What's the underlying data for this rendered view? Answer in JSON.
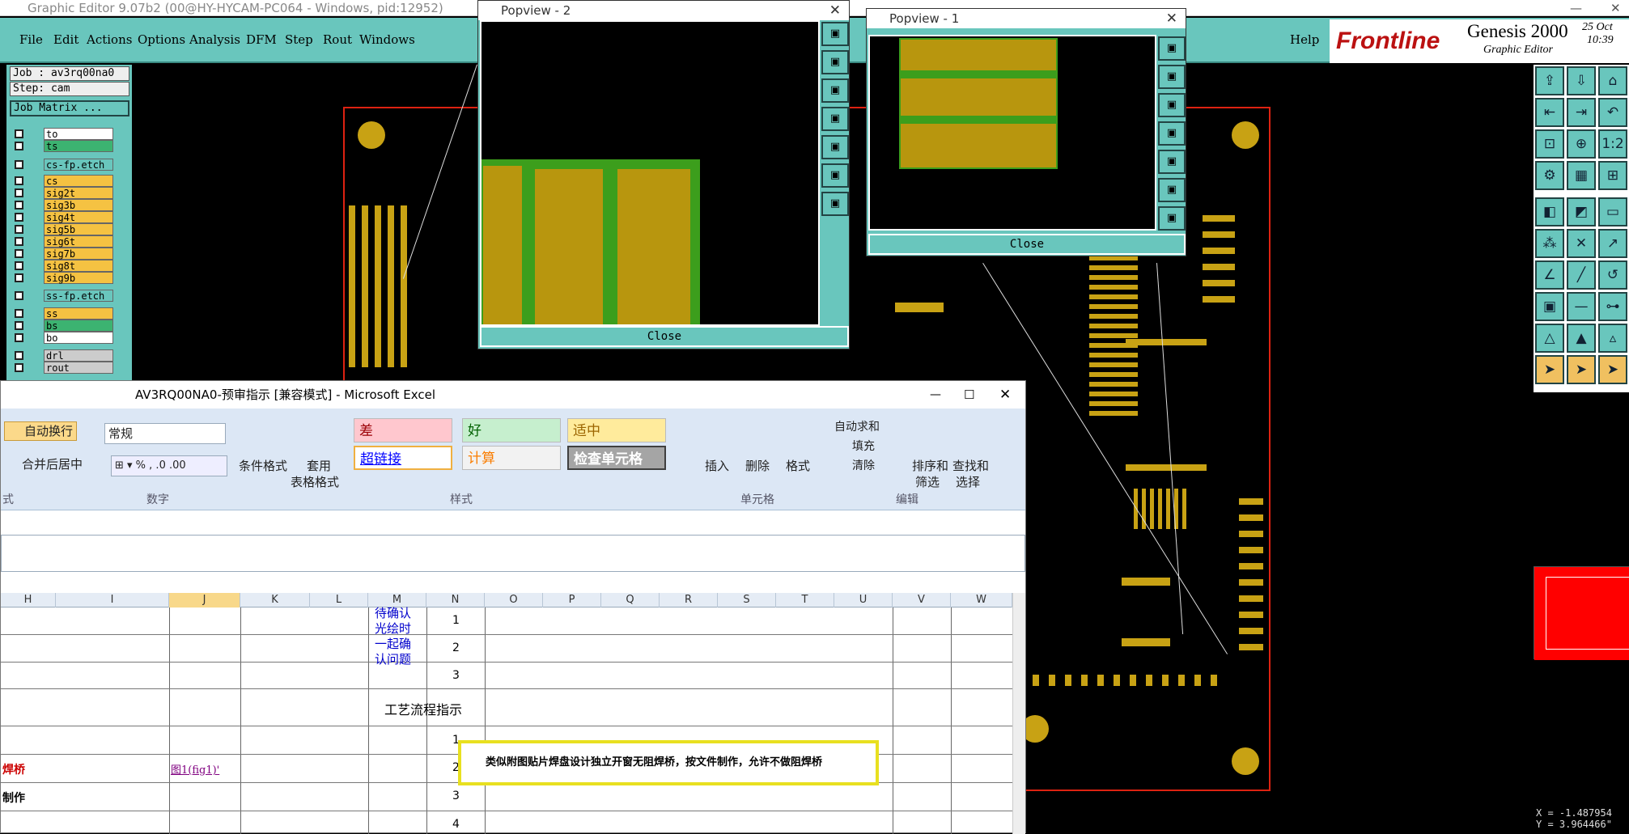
{
  "genesis": {
    "title": "Graphic Editor 9.07b2 (00@HY-HYCAM-PC064 - Windows, pid:12952)",
    "menu": [
      "File",
      "Edit",
      "Actions",
      "Options",
      "Analysis",
      "DFM",
      "Step",
      "Rout",
      "Windows"
    ],
    "help": "Help",
    "brand": "Frontline",
    "product": "Genesis 2000",
    "subtitle": "Graphic Editor",
    "date": "25 Oct",
    "time": "10:39",
    "job": "Job : av3rq00na0",
    "step": "Step: cam",
    "job_matrix": "Job Matrix ...",
    "layers": [
      {
        "name": "to",
        "color": "#ffffff"
      },
      {
        "name": "ts",
        "color": "#3cb371"
      },
      {
        "name": "cs-fp.etch",
        "color": "#69c6bd"
      },
      {
        "name": "cs",
        "color": "#f5c242"
      },
      {
        "name": "sig2t",
        "color": "#f5c242"
      },
      {
        "name": "sig3b",
        "color": "#f5c242"
      },
      {
        "name": "sig4t",
        "color": "#f5c242"
      },
      {
        "name": "sig5b",
        "color": "#f5c242"
      },
      {
        "name": "sig6t",
        "color": "#f5c242"
      },
      {
        "name": "sig7b",
        "color": "#f5c242"
      },
      {
        "name": "sig8t",
        "color": "#f5c242"
      },
      {
        "name": "sig9b",
        "color": "#f5c242"
      },
      {
        "name": "ss-fp.etch",
        "color": "#69c6bd"
      },
      {
        "name": "ss",
        "color": "#f5c242"
      },
      {
        "name": "bs",
        "color": "#3cb371"
      },
      {
        "name": "bo",
        "color": "#ffffff"
      },
      {
        "name": "drl",
        "color": "#cccccc"
      },
      {
        "name": "rout",
        "color": "#cccccc"
      }
    ],
    "coords": [
      "X = -1.487954",
      "Y = 3.964466\""
    ]
  },
  "popview2": {
    "title": "Popview - 2",
    "close": "Close"
  },
  "popview1": {
    "title": "Popview - 1",
    "close": "Close"
  },
  "excel": {
    "title": "AV3RQ00NA0-预审指示  [兼容模式] - Microsoft Excel",
    "wrap": "自动换行",
    "merge": "合并后居中",
    "number_format": "常规",
    "cond_format": "条件格式",
    "table_format_1": "套用",
    "table_format_2": "表格格式",
    "styles": {
      "bad": "差",
      "good": "好",
      "neutral": "适中",
      "hyperlink": "超链接",
      "calc": "计算",
      "check": "检查单元格"
    },
    "insert": "插入",
    "delete": "删除",
    "format": "格式",
    "autosum": "自动求和",
    "fill": "填充",
    "clear": "清除",
    "sort_1": "排序和",
    "sort_2": "筛选",
    "find_1": "查找和",
    "find_2": "选择",
    "group_number": "数字",
    "group_style": "样式",
    "group_cells": "单元格",
    "group_edit": "编辑",
    "group_align": "式",
    "columns": [
      "H",
      "I",
      "J",
      "K",
      "L",
      "M",
      "N",
      "O",
      "P",
      "Q",
      "R",
      "S",
      "T",
      "U",
      "V",
      "W"
    ],
    "m_note": "待确认光绘时一起确认问题",
    "process": "工艺流程指示",
    "nums": [
      "1",
      "2",
      "3",
      "1",
      "2",
      "3",
      "4"
    ],
    "h_red": "焊桥",
    "h_make": "制作",
    "link": "图1(fig1)'",
    "comment": "类似附图贴片焊盘设计独立开窗无阻焊桥，按文件制作，允许不做阻焊桥"
  }
}
